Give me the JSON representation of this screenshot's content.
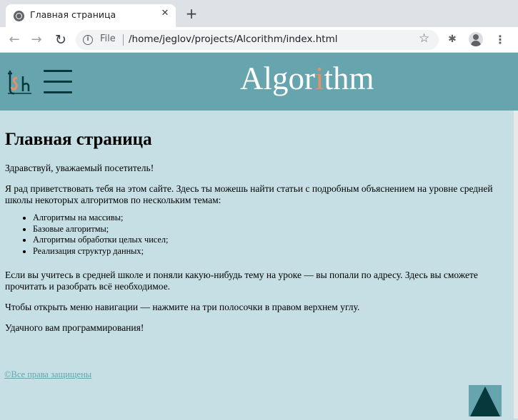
{
  "browser": {
    "tab_title": "Главная страница",
    "tab_close": "✕",
    "new_tab": "+",
    "back": "←",
    "forward": "→",
    "reload": "↻",
    "info": "i",
    "scheme": "File",
    "url": "/home/jeglov/projects/Alcorithm/index.html",
    "bookmark": "☆",
    "extensions": "✱",
    "menu": "⋮"
  },
  "header": {
    "site_title_before": "Algor",
    "site_title_accent": "i",
    "site_title_after": "thm",
    "colors": {
      "header_bg": "#66a5ad",
      "accent": "#e59066",
      "dark": "#07393c",
      "page_bg": "#c6dfe5"
    }
  },
  "main": {
    "heading": "Главная страница",
    "greeting": "Здравствуй, уважаемый посетитель!",
    "intro": "Я рад приветствовать тебя на этом сайте. Здесь ты можешь найти статьи с подробным объяснением на уровне средней школы некоторых алгоритмов по нескольким темам:",
    "topics": [
      "Алгоритмы на массивы;",
      "Базовые алгоритмы;",
      "Алгоритмы обработки целых чисел;",
      "Реализация структур данных;"
    ],
    "school": "Если вы учитесь в средней школе и поняли какую-нибудь тему на уроке — вы попали по адресу. Здесь вы сможете прочитать и разобрать всё необходимое.",
    "nav_hint": "Чтобы открыть меню навигации — нажмите на три полосочки в правом верхнем углу.",
    "farewell": "Удачного вам программирования!"
  },
  "footer": {
    "copyright": "©Все права защищены"
  }
}
